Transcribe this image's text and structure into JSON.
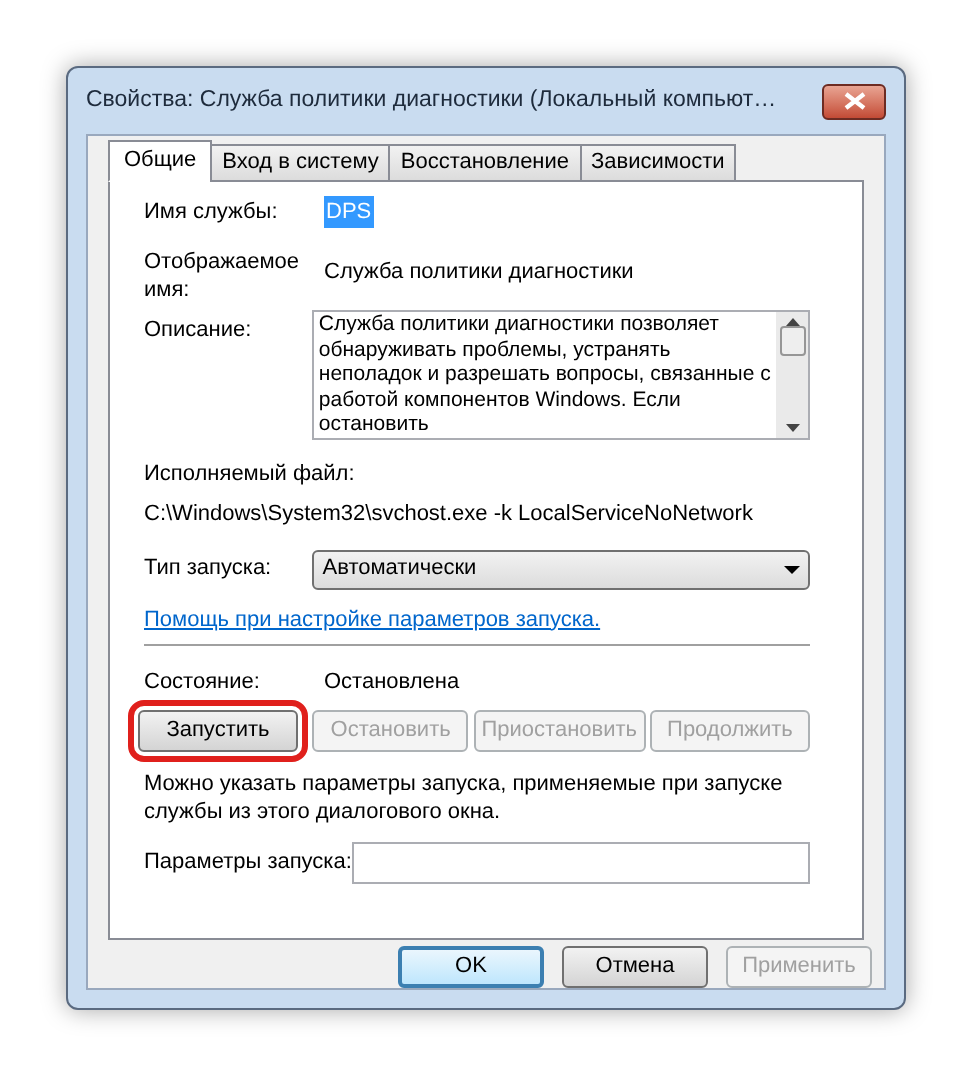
{
  "window": {
    "title": "Свойства: Служба политики диагностики (Локальный компьют…"
  },
  "tabs": [
    {
      "label": "Общие",
      "selected": true
    },
    {
      "label": "Вход в систему",
      "selected": false
    },
    {
      "label": "Восстановление",
      "selected": false
    },
    {
      "label": "Зависимости",
      "selected": false
    }
  ],
  "service_name": {
    "label": "Имя службы:",
    "value": "DPS"
  },
  "display_name": {
    "label": "Отображаемое имя:",
    "value": "Служба политики диагностики"
  },
  "description": {
    "label": "Описание:",
    "value": "Служба политики диагностики позволяет обнаруживать проблемы, устранять неполадок и разрешать вопросы, связанные с работой компонентов Windows.  Если остановить"
  },
  "executable": {
    "label": "Исполняемый файл:",
    "value": "C:\\Windows\\System32\\svchost.exe -k LocalServiceNoNetwork"
  },
  "startup_type": {
    "label": "Тип запуска:",
    "value": "Автоматически"
  },
  "help_link": "Помощь при настройке параметров запуска.",
  "status": {
    "label": "Состояние:",
    "value": "Остановлена"
  },
  "service_buttons": [
    {
      "label": "Запустить",
      "disabled": false,
      "highlighted": true
    },
    {
      "label": "Остановить",
      "disabled": true,
      "highlighted": false
    },
    {
      "label": "Приостановить",
      "disabled": true,
      "highlighted": false
    },
    {
      "label": "Продолжить",
      "disabled": true,
      "highlighted": false
    }
  ],
  "hint": "Можно указать параметры запуска, применяемые при запуске службы из этого диалогового окна.",
  "start_parameters": {
    "label": "Параметры запуска:"
  },
  "dialog_buttons": [
    {
      "label": "OK",
      "disabled": false,
      "default": true
    },
    {
      "label": "Отмена",
      "disabled": false,
      "default": false
    },
    {
      "label": "Применить",
      "disabled": true,
      "default": false
    }
  ]
}
